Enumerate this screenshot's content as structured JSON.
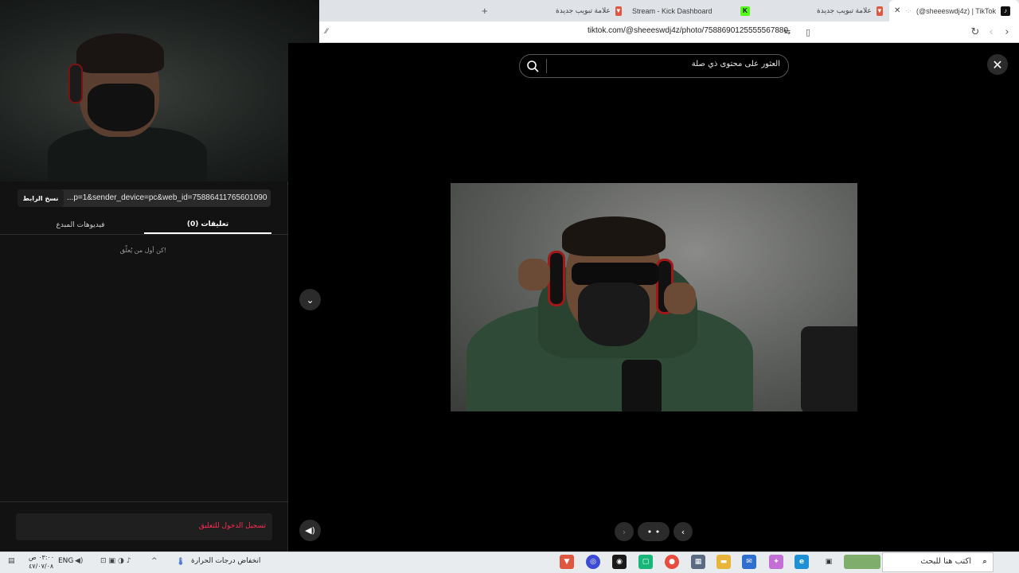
{
  "browser": {
    "tabs": [
      {
        "label": "(@sheeeswdj4z) | TikTok",
        "active": true
      },
      {
        "label": "علامة تبويب جديدة",
        "active": false
      },
      {
        "label": "Stream - Kick Dashboard",
        "active": false
      },
      {
        "label": "علامة تبويب جديدة",
        "active": false
      }
    ],
    "new_tab_symbol": "+",
    "url": "tiktok.com/@sheeeswdj4z/photo/7588690125555567880"
  },
  "viewer": {
    "search_placeholder": "العثور على محتوى ذي صلة",
    "close_symbol": "✕",
    "down_symbol": "⌄",
    "mute_symbol": "🔊",
    "pager": {
      "prev": "›",
      "dots": "• •",
      "next": "‹"
    }
  },
  "panel": {
    "copy_link_label": "نسخ الرابط",
    "link_text": "...p=1&sender_device=pc&web_id=7588641176560109067",
    "tabs": [
      {
        "label": "(0) تعليقات",
        "active": true
      },
      {
        "label": "فيديوهات المبدع",
        "active": false
      }
    ],
    "empty_message": "كن أول من يُعلّق!",
    "login_prompt": "تسجيل الدخول للتعليق"
  },
  "taskbar": {
    "search_placeholder": "اكتب هنا للبحث",
    "weather_text": "انخفاض درجات الحرارة",
    "language": "ENG",
    "time": "٠٣:٠٠ ص",
    "date": "٤٧/٠٧/٠٨"
  },
  "colors": {
    "tiktok_accent": "#fe2c55",
    "viewer_bg": "#000000",
    "panel_bg": "#121212"
  }
}
